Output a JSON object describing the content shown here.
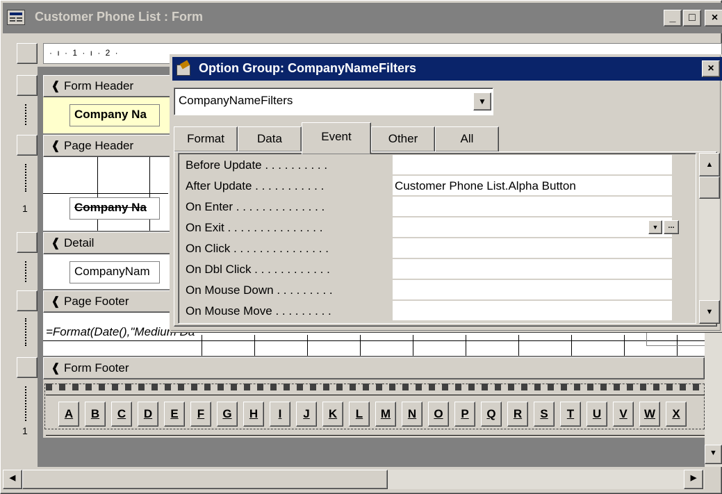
{
  "window": {
    "title": "Customer Phone List : Form",
    "minimize": "_",
    "maximize": "□",
    "close": "×"
  },
  "ruler": {
    "ticks": "· ı · 1 · ı · 2 ·"
  },
  "sections": {
    "form_header": "Form Header",
    "page_header": "Page Header",
    "detail": "Detail",
    "page_footer": "Page Footer",
    "form_footer": "Form Footer"
  },
  "controls": {
    "header_label": "Company Na",
    "page_header_label": "Company Na",
    "detail_field": "CompanyNam",
    "footer_expr": "=Format(Date(),\"Medium Da"
  },
  "side_ruler": {
    "one_a": "1",
    "one_b": "1"
  },
  "letters": [
    "A",
    "B",
    "C",
    "D",
    "E",
    "F",
    "G",
    "H",
    "I",
    "J",
    "K",
    "L",
    "M",
    "N",
    "O",
    "P",
    "Q",
    "R",
    "S",
    "T",
    "U",
    "V",
    "W",
    "X"
  ],
  "property_sheet": {
    "title": "Option Group: CompanyNameFilters",
    "object_selector": "CompanyNameFilters",
    "tabs": [
      "Format",
      "Data",
      "Event",
      "Other",
      "All"
    ],
    "active_tab": "Event",
    "properties": [
      {
        "label": "Before Update . . . . . . . . . .",
        "value": ""
      },
      {
        "label": "After Update . . . . . . . . . . .",
        "value": "Customer Phone List.Alpha Button"
      },
      {
        "label": "On Enter . . . . . . . . . . . . . .",
        "value": ""
      },
      {
        "label": "On Exit . . . . . . . . . . . . . . .",
        "value": ""
      },
      {
        "label": "On Click . . . . . . . . . . . . . . .",
        "value": ""
      },
      {
        "label": "On Dbl Click . . . . . . . . . . . .",
        "value": ""
      },
      {
        "label": "On Mouse Down . . . . . . . . .",
        "value": ""
      },
      {
        "label": "On Mouse Move . . . . . . . . .",
        "value": ""
      }
    ],
    "dropdown_arrow": "▼",
    "builder_button": "..."
  },
  "scroll": {
    "up": "▲",
    "down": "▼",
    "left": "◀",
    "right": "▶"
  }
}
